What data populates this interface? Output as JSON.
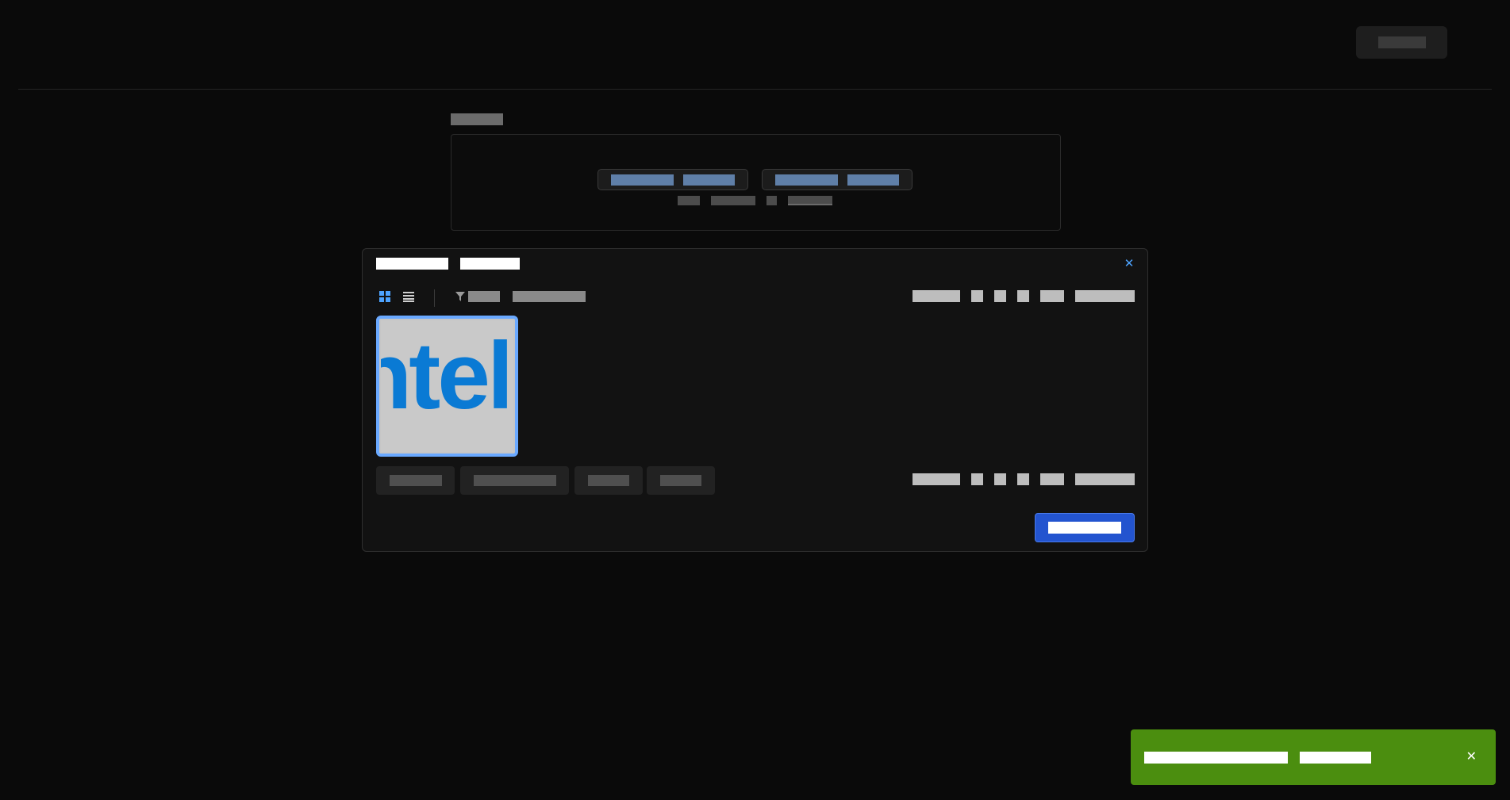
{
  "header": {
    "action_button_label": "",
    "action_button_length": 60
  },
  "upload": {
    "section_label": "",
    "buttons": [
      {
        "label": ""
      },
      {
        "label": ""
      }
    ],
    "hint": ""
  },
  "dialog": {
    "title": "",
    "close_icon": "close-icon",
    "view_modes": [
      {
        "icon": "grid-view-icon",
        "active": true
      },
      {
        "icon": "list-view-icon",
        "active": false
      }
    ],
    "filter": {
      "icon": "filter-icon",
      "label": "",
      "value": ""
    },
    "pagination": {
      "summary": "",
      "pages": [
        "",
        "",
        ""
      ],
      "page_size": "",
      "page_size_label": ""
    },
    "thumbnail": {
      "caption_text": "ntel",
      "selected": true
    },
    "actions": [
      {
        "label": ""
      },
      {
        "label": ""
      },
      {
        "label": ""
      },
      {
        "label": ""
      }
    ],
    "primary_button_label": ""
  },
  "toast": {
    "message": "",
    "close_icon": "close-icon"
  },
  "colors": {
    "background": "#0a0a0a",
    "dialog_bg": "#121212",
    "accent_blue": "#2354cf",
    "selection_blue": "#6aa9ff",
    "toast_green": "#4b8e0f",
    "thumb_logo": "#0a7ad4"
  }
}
